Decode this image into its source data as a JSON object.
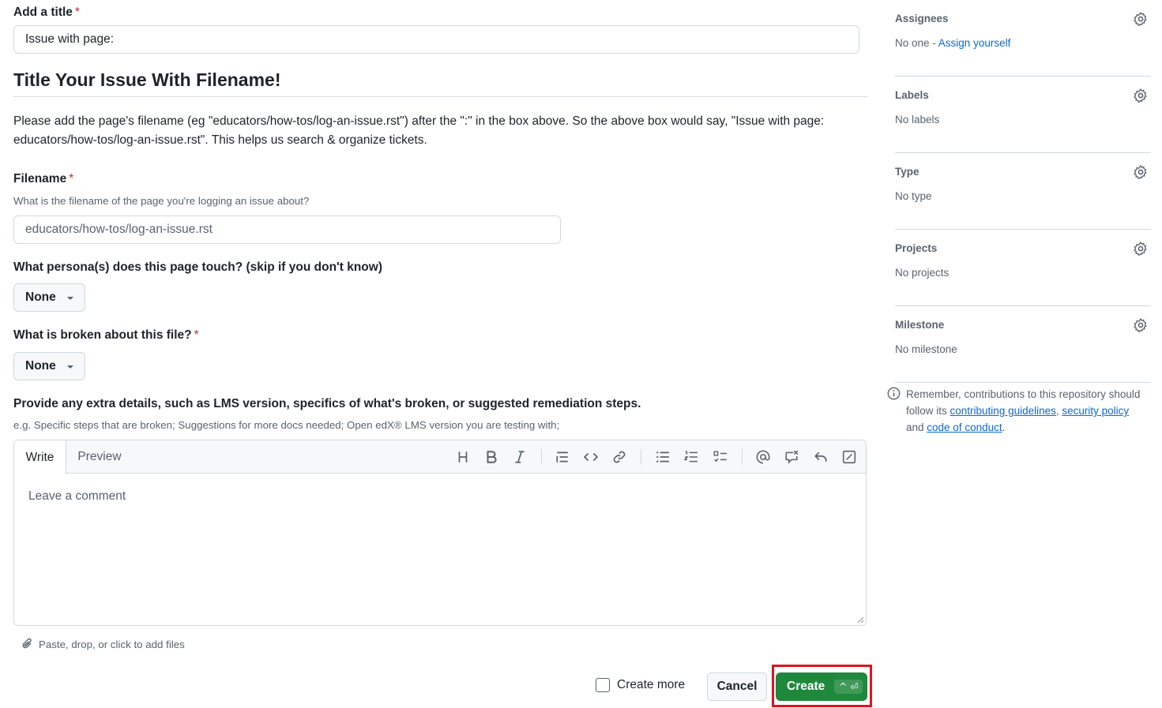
{
  "form": {
    "title_label": "Add a title",
    "required_mark": "*",
    "title_value": "Issue with page:",
    "heading": "Title Your Issue With Filename!",
    "instructions": "Please add the page's filename (eg \"educators/how-tos/log-an-issue.rst\") after the \":\" in the box above. So the above box would say, \"Issue with page: educators/how-tos/log-an-issue.rst\". This helps us search & organize tickets.",
    "filename_label": "Filename",
    "filename_hint": "What is the filename of the page you're logging an issue about?",
    "filename_placeholder": "educators/how-tos/log-an-issue.rst",
    "persona_label": "What persona(s) does this page touch? (skip if you don't know)",
    "persona_value": "None",
    "broken_label": "What is broken about this file?",
    "broken_value": "None",
    "extra_label": "Provide any extra details, such as LMS version, specifics of what's broken, or suggested remediation steps.",
    "extra_hint": "e.g. Specific steps that are broken; Suggestions for more docs needed; Open edX® LMS version you are testing with;"
  },
  "editor": {
    "tab_write": "Write",
    "tab_preview": "Preview",
    "tools": [
      "heading-icon",
      "bold-icon",
      "italic-icon",
      "quote-icon",
      "code-icon",
      "link-icon",
      "unordered-list-icon",
      "ordered-list-icon",
      "task-list-icon",
      "mention-icon",
      "reference-icon",
      "saved-reply-icon",
      "fullscreen-icon"
    ],
    "placeholder": "Leave a comment",
    "attach_text": "Paste, drop, or click to add files"
  },
  "actions": {
    "create_more": "Create more",
    "cancel": "Cancel",
    "create": "Create",
    "shortcut": "^ ⏎"
  },
  "sidebar": {
    "assignees_title": "Assignees",
    "assignees_value": "No one - ",
    "assign_yourself": "Assign yourself",
    "labels_title": "Labels",
    "labels_value": "No labels",
    "type_title": "Type",
    "type_value": "No type",
    "projects_title": "Projects",
    "projects_value": "No projects",
    "milestone_title": "Milestone",
    "milestone_value": "No milestone",
    "note_prefix": "Remember, contributions to this repository should follow its ",
    "link_contributing": "contributing guidelines",
    "note_comma": ", ",
    "link_security": "security policy",
    "note_and": " and ",
    "link_conduct": "code of conduct",
    "note_end": "."
  },
  "colors": {
    "primary_button": "#1f883d",
    "link": "#0969da",
    "required": "#d1242f",
    "highlight_box": "#e0141d"
  }
}
